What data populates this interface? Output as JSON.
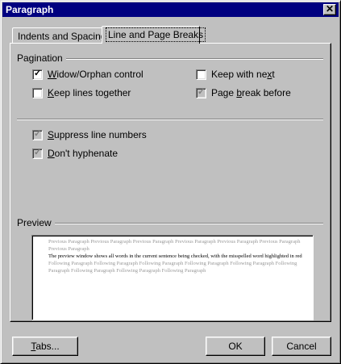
{
  "window": {
    "title": "Paragraph",
    "close_glyph": "✕"
  },
  "tabs": [
    {
      "label": "Indents and Spacing",
      "active": false
    },
    {
      "label": "Line and Page Breaks",
      "active": true
    }
  ],
  "pagination": {
    "label": "Pagination",
    "widow_orphan": {
      "pre": "",
      "key": "W",
      "post": "idow/Orphan control",
      "checked": true
    },
    "keep_lines": {
      "pre": "",
      "key": "K",
      "post": "eep lines together",
      "checked": false
    },
    "keep_next": {
      "pre": "Keep with ne",
      "key": "x",
      "post": "t",
      "checked": false
    },
    "page_break": {
      "pre": "Page ",
      "key": "b",
      "post": "reak before",
      "checked": true,
      "indeterminate": true
    }
  },
  "suppress_line_numbers": {
    "pre": "",
    "key": "S",
    "post": "uppress line numbers",
    "checked": true,
    "indeterminate": true
  },
  "dont_hyphenate": {
    "pre": "",
    "key": "D",
    "post": "on't hyphenate",
    "checked": true,
    "indeterminate": true
  },
  "preview": {
    "label": "Preview",
    "previous": "Previous Paragraph Previous Paragraph Previous Paragraph Previous Paragraph Previous Paragraph Previous Paragraph Previous Paragraph",
    "current": "The preview window shows all words in the current sentence being checked, with the misspelled word highlighted in red",
    "following": "Following Paragraph Following Paragraph Following Paragraph Following Paragraph Following Paragraph Following Paragraph Following Paragraph Following Paragraph Following Paragraph"
  },
  "buttons": {
    "tabs": {
      "key": "T",
      "post": "abs..."
    },
    "ok": "OK",
    "cancel": "Cancel"
  },
  "colors": {
    "titlebar": "#000080",
    "face": "#c0c0c0"
  }
}
